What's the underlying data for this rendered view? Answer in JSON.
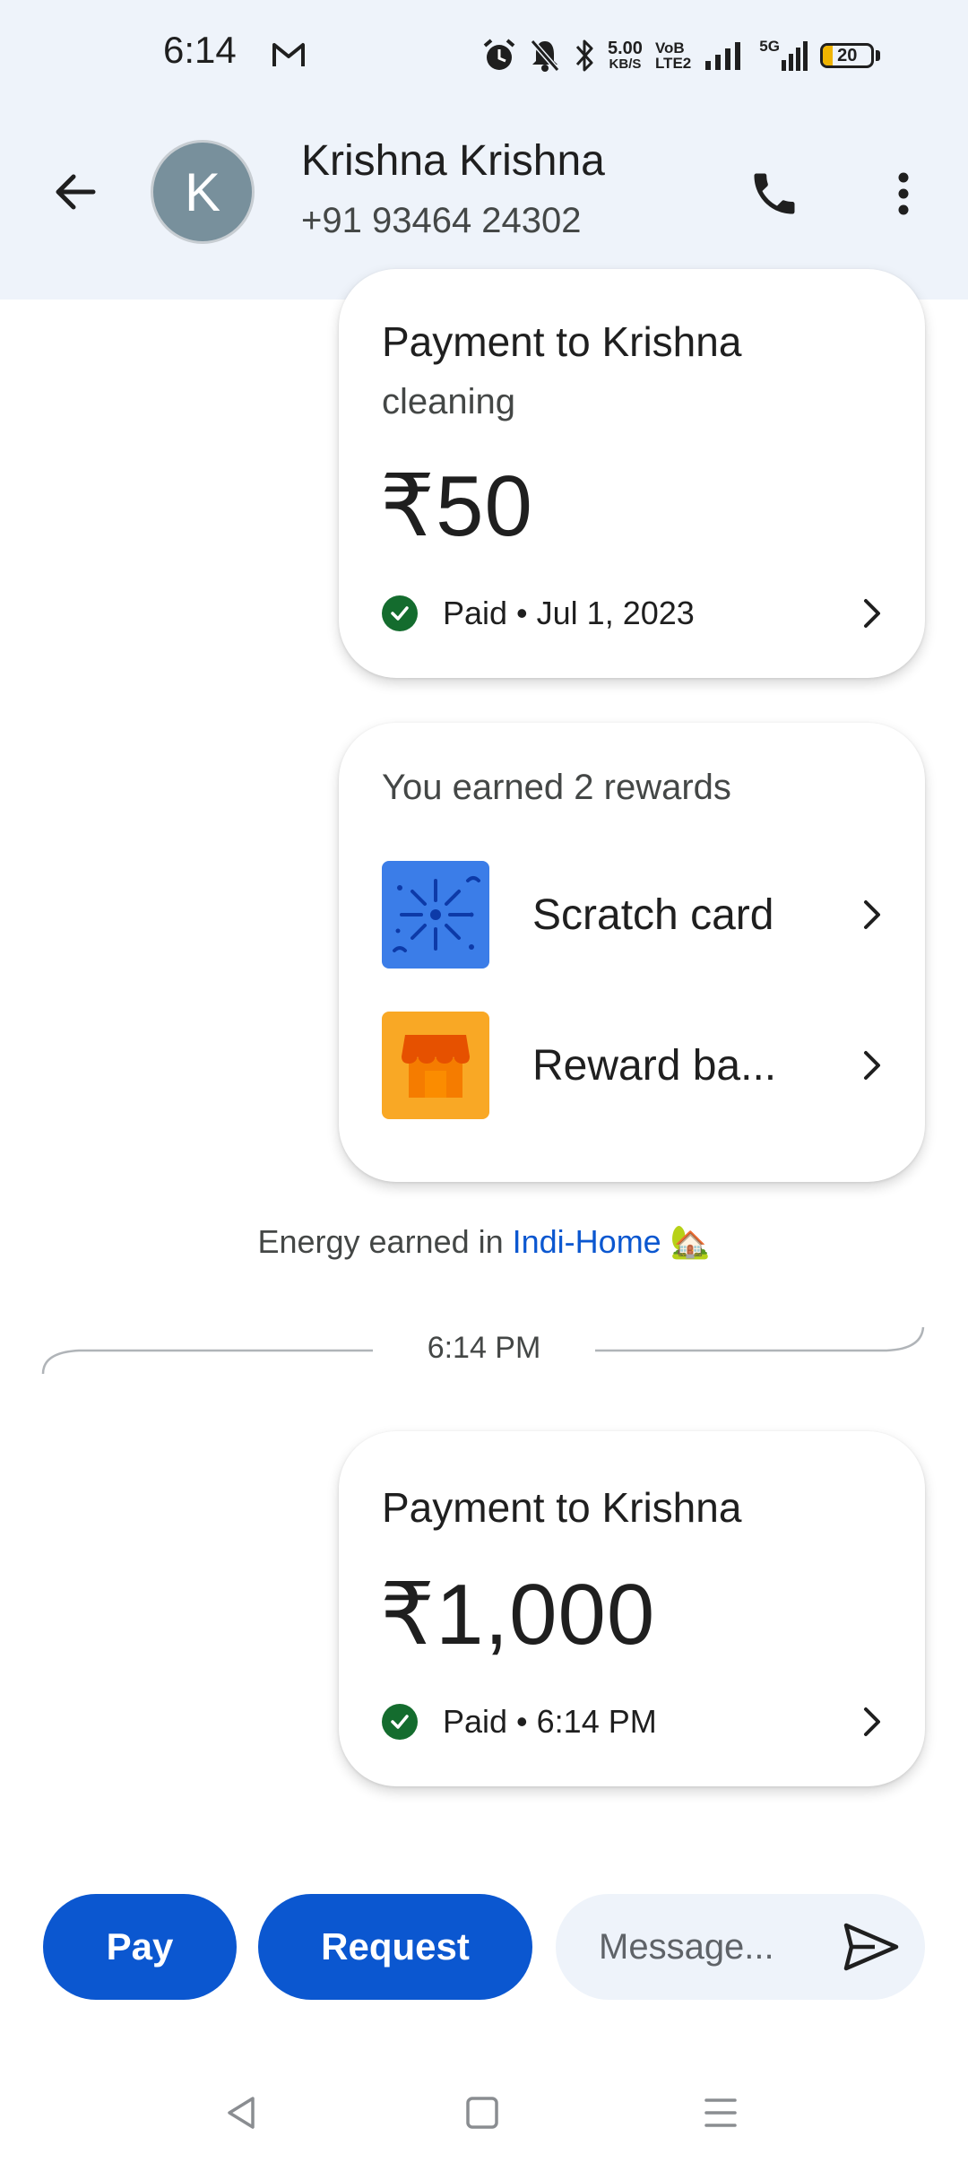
{
  "status_bar": {
    "time": "6:14",
    "net_speed_value": "5.00",
    "net_speed_unit": "KB/S",
    "volte_top": "VoB",
    "volte_bottom": "LTE2",
    "signal2_label": "5G",
    "battery_level": "20",
    "battery_fraction": 0.2
  },
  "header": {
    "avatar_initial": "K",
    "contact_name": "Krishna Krishna",
    "contact_phone": "+91 93464 24302"
  },
  "cards": [
    {
      "title": "Payment to Krishna",
      "note": "cleaning",
      "amount": "₹50",
      "status": "Paid • Jul 1, 2023"
    },
    {
      "title": "Payment to Krishna",
      "amount": "₹1,000",
      "status": "Paid • 6:14 PM"
    }
  ],
  "rewards": {
    "title": "You earned 2 rewards",
    "items": [
      {
        "label": "Scratch card",
        "icon": "scratch-card-icon"
      },
      {
        "label": "Reward ba...",
        "icon": "store-icon"
      }
    ]
  },
  "energy": {
    "prefix": "Energy earned in ",
    "link": "Indi-Home",
    "emoji": "🏡"
  },
  "divider_time": "6:14 PM",
  "composer": {
    "pay_label": "Pay",
    "request_label": "Request",
    "message_placeholder": "Message..."
  },
  "colors": {
    "header_bg": "#eef3fa",
    "primary_blue": "#0b57d0",
    "paid_green": "#146c2e",
    "scratch_blue": "#3b7de8",
    "reward_orange": "#f9a825"
  }
}
